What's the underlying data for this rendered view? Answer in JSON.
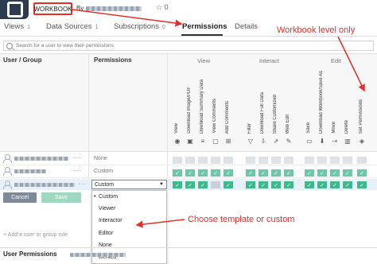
{
  "header": {
    "tag_label": "WORKBOOK",
    "by_prefix": "By",
    "favorites_count": "0"
  },
  "tabs": [
    {
      "label": "Views",
      "count": "1"
    },
    {
      "label": "Data Sources",
      "count": "1"
    },
    {
      "label": "Subscriptions",
      "count": "0"
    },
    {
      "label": "Permissions",
      "count": ""
    },
    {
      "label": "Details",
      "count": ""
    }
  ],
  "search": {
    "placeholder": "Search for a user to view their permissions"
  },
  "table": {
    "col_user_group": "User / Group",
    "col_permissions": "Permissions",
    "categories": [
      "View",
      "Interact",
      "Edit"
    ],
    "capabilities": [
      "View",
      "Download Image/PDF",
      "Download Summary Data",
      "View Comments",
      "Add Comments",
      "Filter",
      "Download Full Data",
      "Share Customized",
      "Web Edit",
      "Save",
      "Download Workbook/Save As",
      "Move",
      "Delete",
      "Set Permissions"
    ],
    "capability_icons": [
      "eye-icon",
      "image-icon",
      "list-icon",
      "comment-icon",
      "add-comment-icon",
      "filter-icon",
      "download-icon",
      "share-icon",
      "pencil-icon",
      "save-icon",
      "download-workbook-icon",
      "move-icon",
      "trash-icon",
      "shield-icon"
    ],
    "rows": [
      {
        "template": "None",
        "cells": [
          "off",
          "off",
          "off",
          "off",
          "off",
          "off",
          "off",
          "off",
          "off",
          "off",
          "off",
          "off",
          "off",
          "off"
        ]
      },
      {
        "template": "Custom",
        "cells": [
          "on",
          "on",
          "on",
          "on",
          "on",
          "on",
          "on",
          "on",
          "on",
          "on",
          "on",
          "on",
          "on",
          "on"
        ]
      },
      {
        "template": "Custom",
        "cells": [
          "on",
          "on",
          "on",
          "off",
          "on",
          "on",
          "on",
          "on",
          "on",
          "on",
          "on",
          "on",
          "on",
          "on"
        ]
      }
    ]
  },
  "editor": {
    "selected_template": "Custom",
    "cancel_label": "Cancel",
    "save_label": "Save"
  },
  "dropdown": {
    "options": [
      "Custom",
      "Viewer",
      "Interactor",
      "Editor",
      "None",
      "Denied"
    ],
    "selected": "Custom"
  },
  "add_rule_label": "+ Add a user or group rule",
  "footer_label": "User Permissions",
  "annotations": {
    "workbook_level": "Workbook level only",
    "choose_template": "Choose template or custom"
  },
  "colors": {
    "annotation_red": "#e0312b",
    "allowed_green": "#6cc8a8",
    "unspecified_gray": "#dde2e6"
  }
}
